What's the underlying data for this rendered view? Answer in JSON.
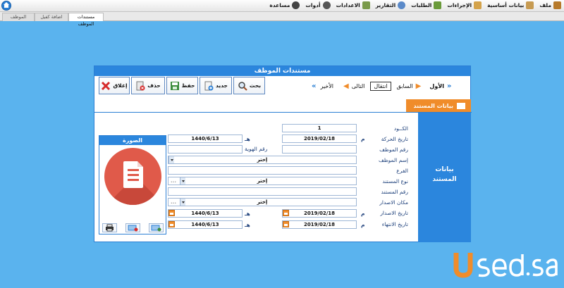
{
  "menubar": {
    "items": [
      {
        "label": "ملف",
        "icon": "file-icon",
        "color": "#b77a2a"
      },
      {
        "label": "بيانات أساسية",
        "icon": "database-icon",
        "color": "#c79b52"
      },
      {
        "label": "الإجراءات",
        "icon": "actions-icon",
        "color": "#d4a34b"
      },
      {
        "label": "الطلبات",
        "icon": "requests-icon",
        "color": "#6a9a3a"
      },
      {
        "label": "التقارير",
        "icon": "reports-icon",
        "color": "#5b8ac9"
      },
      {
        "label": "الاعدادات",
        "icon": "settings-icon",
        "color": "#7a9a4a"
      },
      {
        "label": "أدوات",
        "icon": "tools-icon",
        "color": "#555555"
      },
      {
        "label": "مساعدة",
        "icon": "help-gear-icon",
        "color": "#444444"
      }
    ]
  },
  "tabs": [
    {
      "label": "مستندات الموظف",
      "active": true
    },
    {
      "label": "اضافة كفيل",
      "active": false
    },
    {
      "label": "الموظف",
      "active": false
    }
  ],
  "window": {
    "title": "مستندات الموظف",
    "toolbar": {
      "close": "إغلاق",
      "delete": "حذف",
      "save": "حفظ",
      "new": "جديد",
      "search": "بحث"
    },
    "nav": {
      "first": "الأول",
      "previous": "السابق",
      "goto": "انتقال",
      "next": "التالى",
      "last": "الأخير"
    },
    "section_tab": "بيانات المستند",
    "side_panel": "بيانات المستند",
    "labels": {
      "code": "الكــود",
      "movement_date": "تاريخ الحركة",
      "employee_no": "رقم الموظف",
      "employee_name": "إسم الموظف",
      "branch": "الفرع",
      "doc_type": "نوع المستند",
      "doc_no": "رقم المستند",
      "issue_place": "مكان الاصدار",
      "issue_date": "تاريخ الاصدار",
      "expiry_date": "تاريخ الانتهاء",
      "id_no": "رقم الهوية"
    },
    "values": {
      "code": "1",
      "movement_date_g": "2019/02/18",
      "movement_date_h": "1440/6/13",
      "employee_select": "إختر",
      "doc_type_select": "إختر",
      "doc_type_extra": "...",
      "issue_place_select": "إختر",
      "issue_date_g": "2019/02/18",
      "issue_date_h": "1440/6/13",
      "expiry_date_g": "2019/02/18",
      "expiry_date_h": "1440/6/13"
    },
    "suffix_g": "م",
    "suffix_h": "هـ",
    "photo": {
      "title": "الصورة"
    }
  },
  "colors": {
    "background": "#5ab3ee",
    "accent_blue": "#2b86dd",
    "accent_orange": "#f08c2a",
    "doc_red": "#e05a4a"
  }
}
